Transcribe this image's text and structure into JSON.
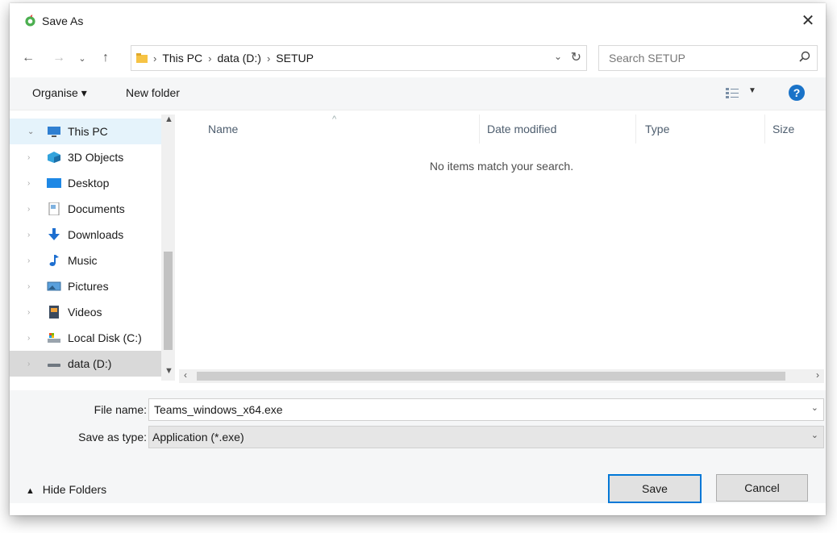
{
  "window": {
    "title": "Save As"
  },
  "address": {
    "crumbs": [
      "This PC",
      "data (D:)",
      "SETUP"
    ]
  },
  "search": {
    "placeholder": "Search SETUP"
  },
  "toolbar": {
    "organise": "Organise ▾",
    "new_folder": "New folder"
  },
  "nav": {
    "items": [
      {
        "label": "This PC"
      },
      {
        "label": "3D Objects"
      },
      {
        "label": "Desktop"
      },
      {
        "label": "Documents"
      },
      {
        "label": "Downloads"
      },
      {
        "label": "Music"
      },
      {
        "label": "Pictures"
      },
      {
        "label": "Videos"
      },
      {
        "label": "Local Disk (C:)"
      },
      {
        "label": "data (D:)"
      }
    ]
  },
  "columns": {
    "name": "Name",
    "date": "Date modified",
    "type": "Type",
    "size": "Size"
  },
  "empty_message": "No items match your search.",
  "fields": {
    "file_name_label": "File name:",
    "file_name_value": "Teams_windows_x64.exe",
    "type_label": "Save as type:",
    "type_value": "Application (*.exe)"
  },
  "footer": {
    "hide_folders": "Hide Folders",
    "save": "Save",
    "cancel": "Cancel"
  },
  "colors": {
    "accent": "#0078d7",
    "help": "#1a73c8",
    "selected": "#e5f3fb"
  }
}
